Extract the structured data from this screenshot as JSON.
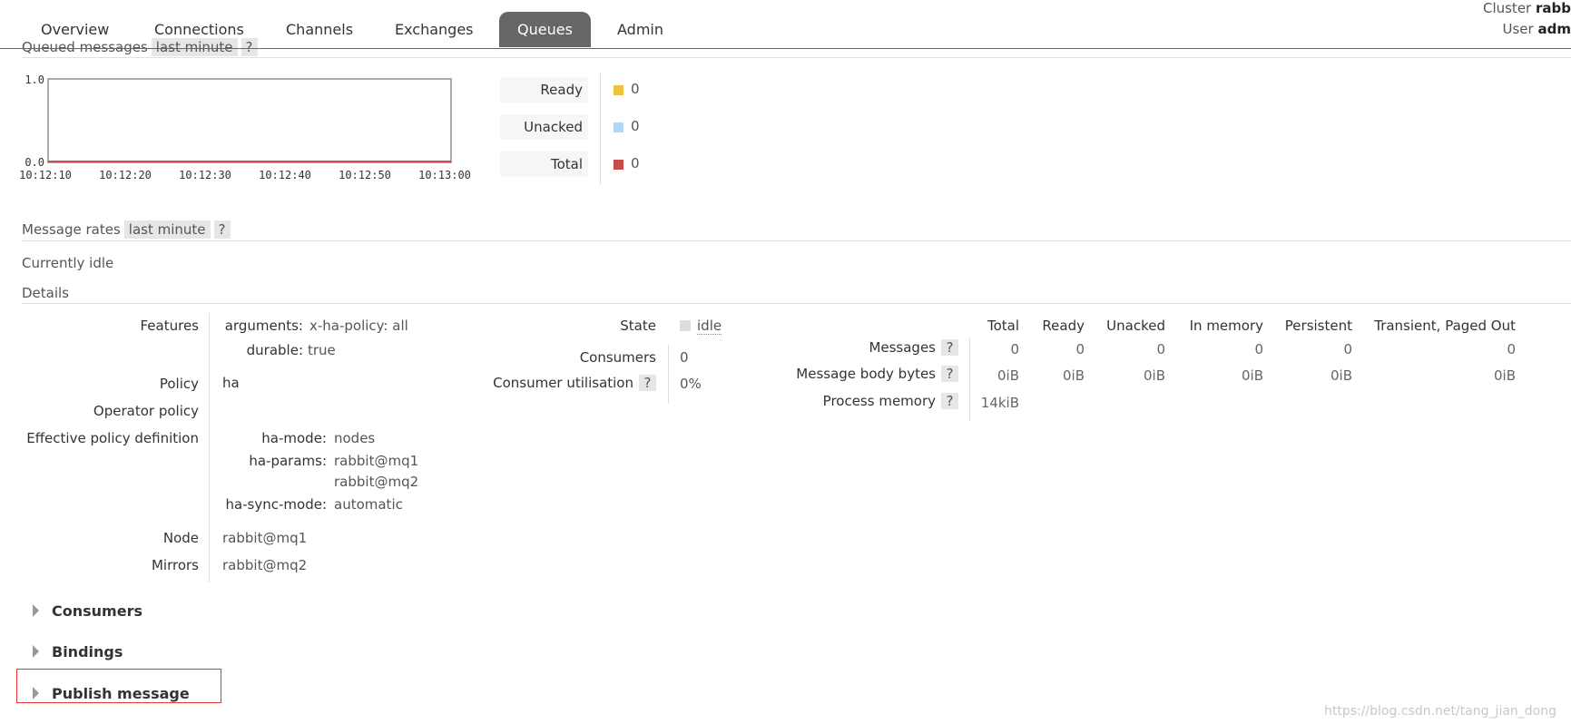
{
  "nav": {
    "tabs": [
      "Overview",
      "Connections",
      "Channels",
      "Exchanges",
      "Queues",
      "Admin"
    ],
    "active_tab": "Queues",
    "cluster_label": "Cluster",
    "cluster_value": "rabb",
    "user_label": "User",
    "user_value": "adm"
  },
  "queued_messages": {
    "title": "Queued messages",
    "range": "last minute",
    "help": "?",
    "chart_data": {
      "type": "line",
      "x": [
        "10:12:10",
        "10:12:20",
        "10:12:30",
        "10:12:40",
        "10:12:50",
        "10:13:00"
      ],
      "ylim": [
        0.0,
        1.0
      ],
      "y_ticks": [
        "1.0",
        "0.0"
      ],
      "series": [
        {
          "name": "Ready",
          "values": [
            0,
            0,
            0,
            0,
            0,
            0
          ]
        },
        {
          "name": "Unacked",
          "values": [
            0,
            0,
            0,
            0,
            0,
            0
          ]
        },
        {
          "name": "Total",
          "values": [
            0,
            0,
            0,
            0,
            0,
            0
          ]
        }
      ]
    },
    "legend": [
      {
        "label": "Ready",
        "value": "0",
        "color": "#edc240"
      },
      {
        "label": "Unacked",
        "value": "0",
        "color": "#afd8f8"
      },
      {
        "label": "Total",
        "value": "0",
        "color": "#cb4b4b"
      }
    ]
  },
  "message_rates": {
    "title": "Message rates",
    "range": "last minute",
    "help": "?",
    "status": "Currently idle"
  },
  "details": {
    "title": "Details",
    "features_label": "Features",
    "features": [
      {
        "key": "arguments:",
        "value": "x-ha-policy: all"
      },
      {
        "key": "durable:",
        "value": "true"
      }
    ],
    "policy_label": "Policy",
    "policy_value": "ha",
    "operator_policy_label": "Operator policy",
    "effective_label": "Effective policy definition",
    "effective": {
      "ha_mode_key": "ha-mode:",
      "ha_mode_value": "nodes",
      "ha_params_key": "ha-params:",
      "ha_params_values": [
        "rabbit@mq1",
        "rabbit@mq2"
      ],
      "ha_sync_key": "ha-sync-mode:",
      "ha_sync_value": "automatic"
    },
    "node_label": "Node",
    "node_value": "rabbit@mq1",
    "mirrors_label": "Mirrors",
    "mirrors_value": "rabbit@mq2",
    "state_label": "State",
    "state_value": "idle",
    "consumers_label": "Consumers",
    "consumers_value": "0",
    "utilisation_label": "Consumer utilisation",
    "utilisation_value": "0%",
    "help": "?",
    "stats": {
      "columns": [
        "Total",
        "Ready",
        "Unacked",
        "In memory",
        "Persistent",
        "Transient, Paged Out"
      ],
      "rows": [
        {
          "label": "Messages",
          "values": [
            "0",
            "0",
            "0",
            "0",
            "0",
            "0"
          ]
        },
        {
          "label": "Message body bytes",
          "values": [
            "0iB",
            "0iB",
            "0iB",
            "0iB",
            "0iB",
            "0iB"
          ]
        },
        {
          "label": "Process memory",
          "values": [
            "14kiB"
          ]
        }
      ]
    }
  },
  "sections": [
    "Consumers",
    "Bindings",
    "Publish message"
  ],
  "watermark": "https://blog.csdn.net/tang_jian_dong"
}
